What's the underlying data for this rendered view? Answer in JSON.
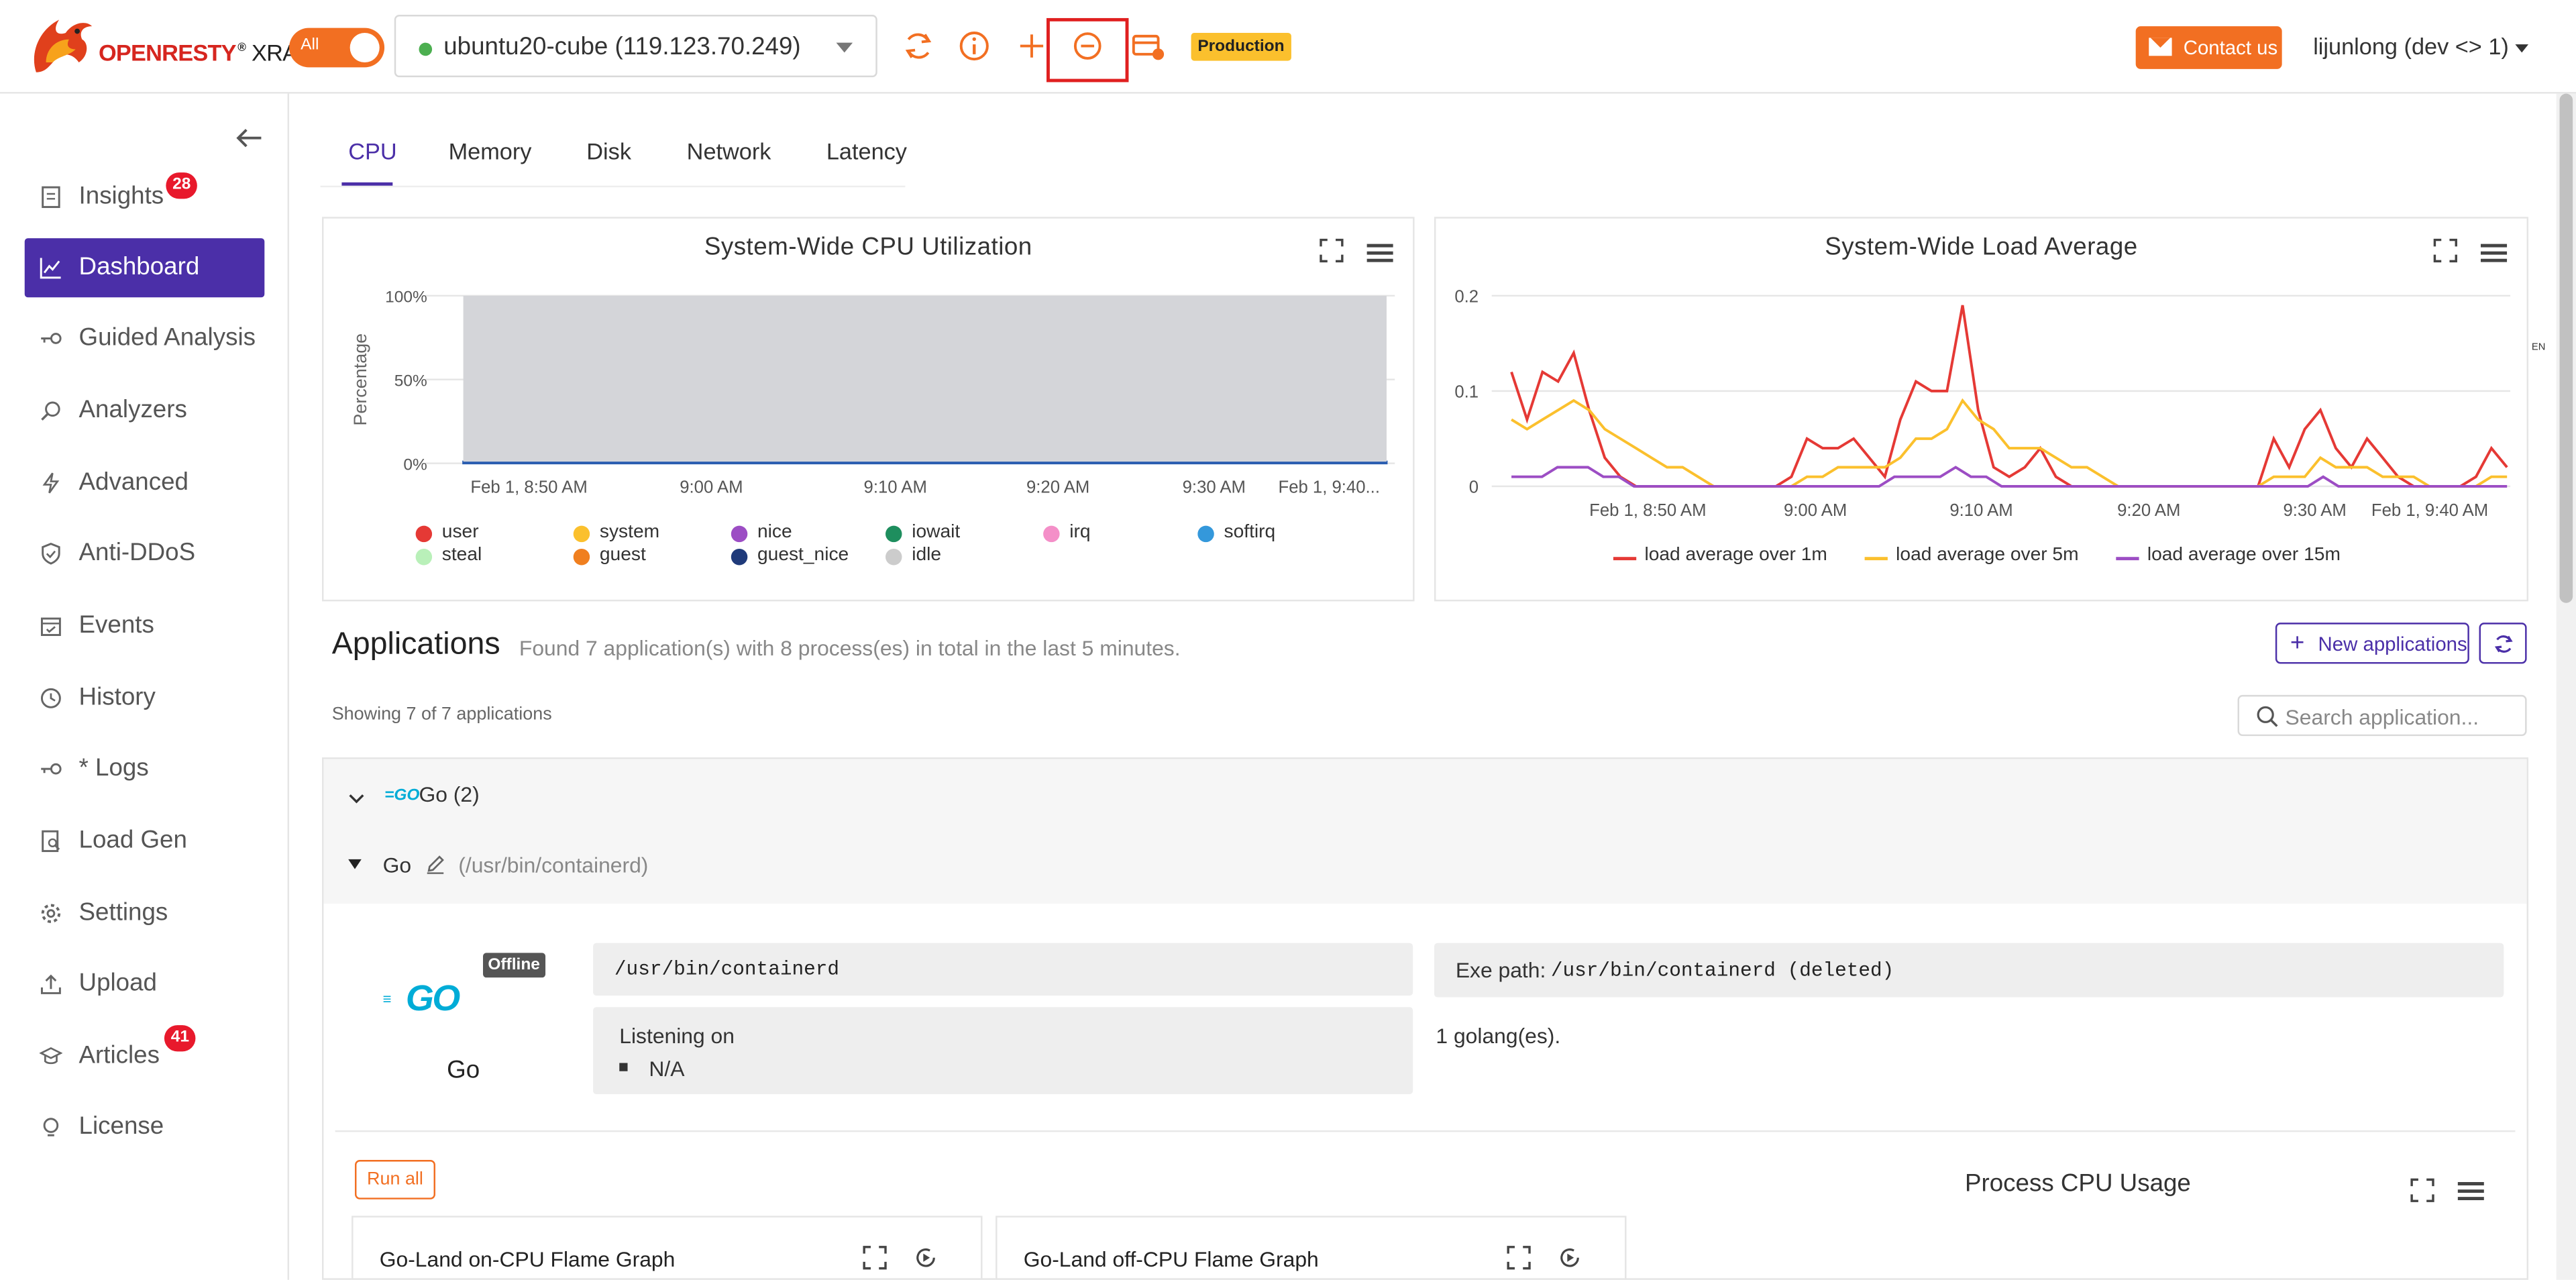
{
  "header": {
    "logo_text": "OPENRESTY",
    "logo_reg": "®",
    "logo_sub": "XRAY",
    "toggle_label": "All",
    "host": "ubuntu20-cube (119.123.70.249)",
    "env_badge": "Production",
    "contact_label": "Contact us",
    "user": "lijunlong (dev <> 1)",
    "icons": [
      "refresh-icon",
      "info-icon",
      "plus-icon",
      "minus-circle-icon",
      "billing-card-icon"
    ],
    "accent": "#f26f22"
  },
  "sidebar": {
    "items": [
      {
        "label": "Insights",
        "badge": "28",
        "icon": "document-icon"
      },
      {
        "label": "Dashboard",
        "icon": "line-chart-icon",
        "active": true
      },
      {
        "label": "Guided Analysis",
        "icon": "key-icon"
      },
      {
        "label": "Analyzers",
        "icon": "magnifier-icon"
      },
      {
        "label": "Advanced",
        "icon": "bolt-icon"
      },
      {
        "label": "Anti-DDoS",
        "icon": "shield-icon"
      },
      {
        "label": "Events",
        "icon": "calendar-icon"
      },
      {
        "label": "History",
        "icon": "clock-icon"
      },
      {
        "label": "* Logs",
        "icon": "key-icon"
      },
      {
        "label": "Load Gen",
        "icon": "file-search-icon"
      },
      {
        "label": "Settings",
        "icon": "gear-icon"
      },
      {
        "label": "Upload",
        "icon": "upload-icon"
      },
      {
        "label": "Articles",
        "badge": "41",
        "icon": "graduation-cap-icon"
      },
      {
        "label": "License",
        "icon": "bulb-icon"
      }
    ],
    "active_color": "#4b2fa8"
  },
  "tabs": [
    "CPU",
    "Memory",
    "Disk",
    "Network",
    "Latency"
  ],
  "apps": {
    "title": "Applications",
    "subtitle": "Found 7 application(s) with 8 process(es) in total in the last 5 minutes.",
    "new_button": "New applications",
    "showing": "Showing 7 of 7 applications",
    "search_placeholder": "Search application...",
    "group_label": "Go (2)",
    "process": {
      "name": "Go",
      "path": "(/usr/bin/containerd)",
      "status": "Offline",
      "display_name": "Go",
      "logo_text": "GO",
      "cmd": "/usr/bin/containerd",
      "exe_label": "Exe path:",
      "exe_path": "/usr/bin/containerd (deleted)",
      "listening_label": "Listening on",
      "listening_value": "N/A",
      "langs": "1 golang(es)."
    },
    "run_all": "Run all",
    "pcu_title": "Process CPU Usage",
    "flame_graphs": [
      "Go-Land on-CPU Flame Graph",
      "Go-Land off-CPU Flame Graph"
    ]
  },
  "lang_mark": "EN",
  "chart_data": [
    {
      "type": "area",
      "title": "System-Wide CPU Utilization",
      "ylabel": "Percentage",
      "yticks": [
        "100%",
        "50%",
        "0%"
      ],
      "ylim": [
        0,
        100
      ],
      "xticks": [
        "Feb 1, 8:50 AM",
        "9:00 AM",
        "9:10 AM",
        "9:20 AM",
        "9:30 AM",
        "Feb 1, 9:40..."
      ],
      "series": [
        {
          "name": "user",
          "color": "#e53935",
          "values": [
            1,
            1,
            1,
            1,
            1,
            1,
            1,
            1,
            1,
            1,
            1,
            1,
            1,
            1,
            1,
            1,
            1,
            1,
            1,
            1,
            1,
            1,
            1,
            1,
            1,
            1,
            1,
            1,
            1,
            1,
            1
          ]
        },
        {
          "name": "system",
          "color": "#fbc02d",
          "values": [
            0,
            0,
            0,
            0,
            0,
            0,
            0,
            0,
            0,
            0,
            0,
            0,
            0,
            0,
            0,
            0,
            0,
            0,
            0,
            0,
            0,
            0,
            0,
            0,
            0,
            0,
            0,
            0,
            0,
            0,
            0
          ]
        },
        {
          "name": "nice",
          "color": "#9c4dc4",
          "values": [
            0,
            0,
            0,
            0,
            0,
            0,
            0,
            0,
            0,
            0,
            0,
            0,
            0,
            0,
            0,
            0,
            0,
            0,
            0,
            0,
            0,
            0,
            0,
            0,
            0,
            0,
            0,
            0,
            0,
            0,
            0
          ]
        },
        {
          "name": "iowait",
          "color": "#1e8e5e",
          "values": [
            0,
            0,
            0,
            0,
            0,
            0,
            0,
            0,
            0,
            0,
            0,
            0,
            0,
            0,
            0,
            0,
            0,
            0,
            0,
            0,
            0,
            0,
            0,
            0,
            0,
            0,
            0,
            0,
            0,
            0,
            0
          ]
        },
        {
          "name": "irq",
          "color": "#f48fc8",
          "values": [
            0,
            0,
            0,
            0,
            0,
            0,
            0,
            0,
            0,
            0,
            0,
            0,
            0,
            0,
            0,
            0,
            0,
            0,
            0,
            0,
            0,
            0,
            0,
            0,
            0,
            0,
            0,
            0,
            0,
            0,
            0
          ]
        },
        {
          "name": "softirq",
          "color": "#3498db",
          "values": [
            0,
            0,
            0,
            0,
            0,
            0,
            0,
            0,
            0,
            0,
            0,
            0,
            0,
            0,
            0,
            0,
            0,
            0,
            0,
            0,
            0,
            0,
            0,
            0,
            0,
            0,
            0,
            0,
            0,
            0,
            0
          ]
        },
        {
          "name": "steal",
          "color": "#b9f0b9",
          "values": [
            0,
            0,
            0,
            0,
            0,
            0,
            0,
            0,
            0,
            0,
            0,
            0,
            0,
            0,
            0,
            0,
            0,
            0,
            0,
            0,
            0,
            0,
            0,
            0,
            0,
            0,
            0,
            0,
            0,
            0,
            0
          ]
        },
        {
          "name": "guest",
          "color": "#f07f1f",
          "values": [
            0,
            0,
            0,
            0,
            0,
            0,
            0,
            0,
            0,
            0,
            0,
            0,
            0,
            0,
            0,
            0,
            0,
            0,
            0,
            0,
            0,
            0,
            0,
            0,
            0,
            0,
            0,
            0,
            0,
            0,
            0
          ]
        },
        {
          "name": "guest_nice",
          "color": "#1f3a7a",
          "values": [
            0,
            0,
            0,
            0,
            0,
            0,
            0,
            0,
            0,
            0,
            0,
            0,
            0,
            0,
            0,
            0,
            0,
            0,
            0,
            0,
            0,
            0,
            0,
            0,
            0,
            0,
            0,
            0,
            0,
            0,
            0
          ]
        },
        {
          "name": "idle",
          "color": "#cccccc",
          "values": [
            99,
            99,
            99,
            99,
            99,
            99,
            99,
            99,
            99,
            99,
            99,
            99,
            99,
            99,
            99,
            99,
            99,
            99,
            99,
            99,
            99,
            99,
            99,
            99,
            99,
            99,
            99,
            99,
            99,
            99,
            99
          ]
        }
      ],
      "legend": "bottom"
    },
    {
      "type": "line",
      "title": "System-Wide Load Average",
      "yticks": [
        "0.2",
        "0.1",
        "0"
      ],
      "ylim": [
        0,
        0.2
      ],
      "xticks": [
        "Feb 1, 8:50 AM",
        "9:00 AM",
        "9:10 AM",
        "9:20 AM",
        "9:30 AM",
        "Feb 1, 9:40 AM"
      ],
      "legend": "bottom",
      "series": [
        {
          "name": "load average over 1m",
          "color": "#e53935",
          "values": [
            0.12,
            0.07,
            0.12,
            0.11,
            0.14,
            0.08,
            0.03,
            0.01,
            0,
            0,
            0,
            0,
            0,
            0,
            0,
            0,
            0,
            0,
            0.01,
            0.05,
            0.04,
            0.04,
            0.05,
            0.03,
            0.01,
            0.07,
            0.11,
            0.1,
            0.1,
            0.19,
            0.08,
            0.02,
            0.01,
            0.02,
            0.04,
            0.01,
            0,
            0,
            0,
            0,
            0,
            0,
            0,
            0,
            0,
            0,
            0,
            0,
            0,
            0.05,
            0.02,
            0.06,
            0.08,
            0.04,
            0.02,
            0.05,
            0.03,
            0.01,
            0,
            0,
            0,
            0,
            0.01,
            0.04,
            0.02
          ]
        },
        {
          "name": "load average over 5m",
          "color": "#fbc02d",
          "values": [
            0.07,
            0.06,
            0.07,
            0.08,
            0.09,
            0.08,
            0.06,
            0.05,
            0.04,
            0.03,
            0.02,
            0.02,
            0.01,
            0,
            0,
            0,
            0,
            0,
            0,
            0.01,
            0.01,
            0.02,
            0.02,
            0.02,
            0.02,
            0.03,
            0.05,
            0.05,
            0.06,
            0.09,
            0.07,
            0.06,
            0.04,
            0.04,
            0.04,
            0.03,
            0.02,
            0.02,
            0.01,
            0,
            0,
            0,
            0,
            0,
            0,
            0,
            0,
            0,
            0,
            0.01,
            0.01,
            0.01,
            0.03,
            0.02,
            0.02,
            0.02,
            0.01,
            0.01,
            0.01,
            0,
            0,
            0,
            0,
            0.01,
            0.01
          ]
        },
        {
          "name": "load average over 15m",
          "color": "#9c4dc4",
          "values": [
            0.01,
            0.01,
            0.01,
            0.02,
            0.02,
            0.02,
            0.01,
            0.01,
            0,
            0,
            0,
            0,
            0,
            0,
            0,
            0,
            0,
            0,
            0,
            0,
            0,
            0,
            0,
            0,
            0,
            0.01,
            0.01,
            0.01,
            0.01,
            0.02,
            0.01,
            0.01,
            0,
            0,
            0,
            0,
            0,
            0,
            0,
            0,
            0,
            0,
            0,
            0,
            0,
            0,
            0,
            0,
            0,
            0,
            0,
            0,
            0,
            0.01,
            0,
            0,
            0,
            0,
            0,
            0,
            0,
            0,
            0,
            0,
            0,
            0
          ]
        }
      ]
    }
  ]
}
